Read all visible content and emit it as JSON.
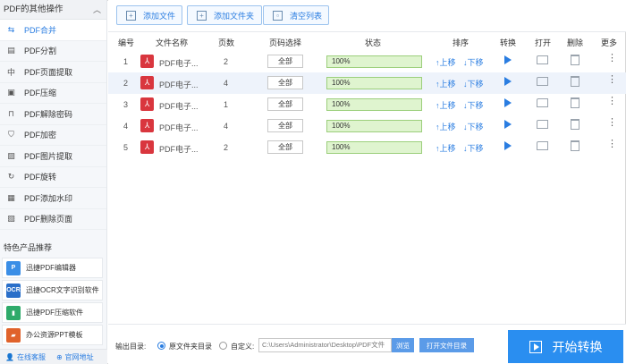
{
  "colors": {
    "accent": "#2a7de1",
    "pdf_red": "#d9363e",
    "progress_green": "#dff4cf",
    "start_button": "#2a8ef0"
  },
  "sidebar": {
    "header": "PDF的其他操作",
    "items": [
      {
        "label": "PDF合并",
        "icon": "merge-icon",
        "active": true
      },
      {
        "label": "PDF分割",
        "icon": "split-icon"
      },
      {
        "label": "PDF页面提取",
        "icon": "extract-icon"
      },
      {
        "label": "PDF压缩",
        "icon": "compress-icon"
      },
      {
        "label": "PDF解除密码",
        "icon": "unlock-icon"
      },
      {
        "label": "PDF加密",
        "icon": "shield-icon"
      },
      {
        "label": "PDF图片提取",
        "icon": "image-icon"
      },
      {
        "label": "PDF旋转",
        "icon": "rotate-icon"
      },
      {
        "label": "PDF添加水印",
        "icon": "watermark-icon"
      },
      {
        "label": "PDF删除页面",
        "icon": "delete-page-icon"
      }
    ],
    "featured_title": "特色产品推荐",
    "featured": [
      {
        "label": "迅捷PDF编辑器",
        "icon": "pdf-editor-logo"
      },
      {
        "label": "迅捷OCR文字识别软件",
        "icon": "ocr-logo"
      },
      {
        "label": "迅捷PDF压缩软件",
        "icon": "compress-logo"
      },
      {
        "label": "办公资源PPT模板",
        "icon": "ppt-logo"
      }
    ],
    "footer": {
      "support": "在线客服",
      "website": "官网地址"
    }
  },
  "toolbar": {
    "add_file": "添加文件",
    "add_folder": "添加文件夹",
    "clear_list": "清空列表"
  },
  "table": {
    "headers": {
      "num": "编号",
      "name": "文件名称",
      "pages": "页数",
      "page_select": "页码选择",
      "status": "状态",
      "order": "排序",
      "convert": "转换",
      "open": "打开",
      "delete": "删除",
      "more": "更多"
    },
    "rows": [
      {
        "num": "1",
        "name": "PDF电子...",
        "pages": "2",
        "page_select": "全部",
        "progress": "100%",
        "up": "↑上移",
        "down": "↓下移"
      },
      {
        "num": "2",
        "name": "PDF电子...",
        "pages": "4",
        "page_select": "全部",
        "progress": "100%",
        "up": "↑上移",
        "down": "↓下移"
      },
      {
        "num": "3",
        "name": "PDF电子...",
        "pages": "1",
        "page_select": "全部",
        "progress": "100%",
        "up": "↑上移",
        "down": "↓下移"
      },
      {
        "num": "4",
        "name": "PDF电子...",
        "pages": "4",
        "page_select": "全部",
        "progress": "100%",
        "up": "↑上移",
        "down": "↓下移"
      },
      {
        "num": "5",
        "name": "PDF电子...",
        "pages": "2",
        "page_select": "全部",
        "progress": "100%",
        "up": "↑上移",
        "down": "↓下移"
      }
    ]
  },
  "output": {
    "label": "输出目录:",
    "option_source": "原文件夹目录",
    "option_custom": "自定义:",
    "path": "C:\\Users\\Administrator\\Desktop\\PDF文件",
    "browse": "浏览",
    "open_folder": "打开文件目录",
    "start": "开始转换"
  }
}
